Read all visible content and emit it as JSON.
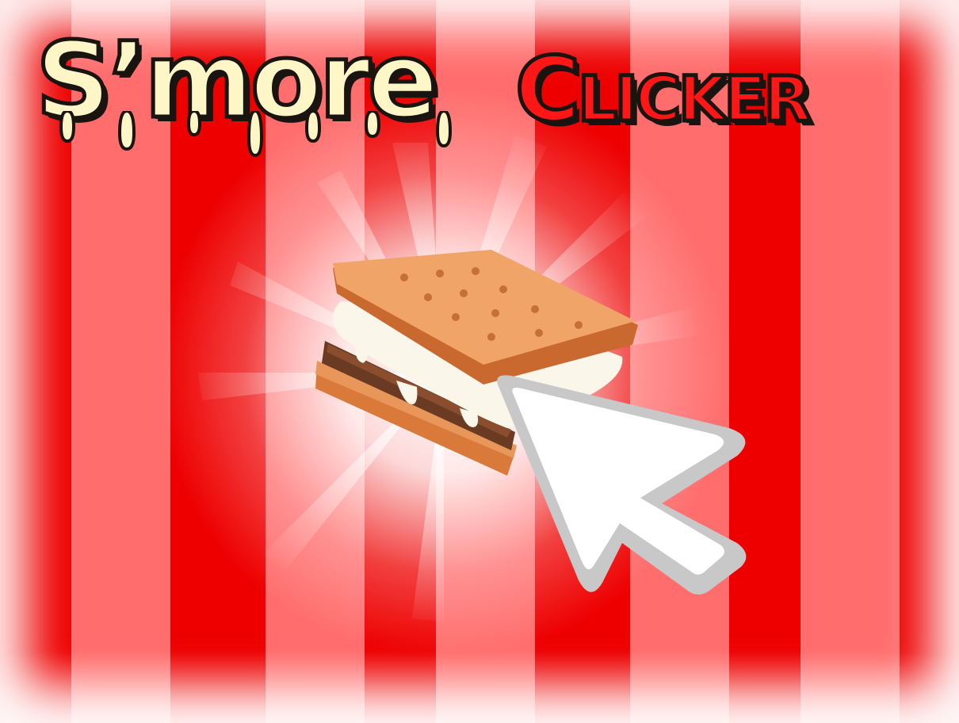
{
  "game": {
    "title_part1": "S’more",
    "title_part2": "Clicker"
  },
  "icons": {
    "main_button": "smore-icon",
    "pointer": "cursor-arrow-icon"
  },
  "colors": {
    "stripe_dark": "#ee0000",
    "stripe_light": "#ff6d6d",
    "title_cream": "#fff6c8",
    "title_red": "#ff1616",
    "outline": "#1a1410",
    "graham": "#e8965a",
    "chocolate": "#6b3a22",
    "marshmallow": "#fbf6ea"
  }
}
